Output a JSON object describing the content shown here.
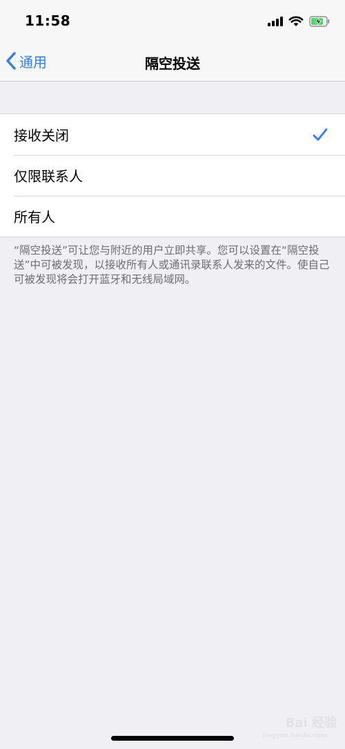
{
  "status_bar": {
    "time": "11:58"
  },
  "nav": {
    "back_label": "通用",
    "title": "隔空投送"
  },
  "options": [
    {
      "label": "接收关闭",
      "selected": true
    },
    {
      "label": "仅限联系人",
      "selected": false
    },
    {
      "label": "所有人",
      "selected": false
    }
  ],
  "footer": "“隔空投送”可让您与附近的用户立即共享。您可以设置在“隔空投送”中可被发现，以接收所有人或通讯录联系人发来的文件。使自己可被发现将会打开蓝牙和无线局域网。",
  "watermark": {
    "text": "Bai 经验",
    "url": "jingyan.baidu.com"
  },
  "colors": {
    "accent": "#2f7cf6",
    "background": "#efeff4",
    "battery": "#4cd964"
  }
}
